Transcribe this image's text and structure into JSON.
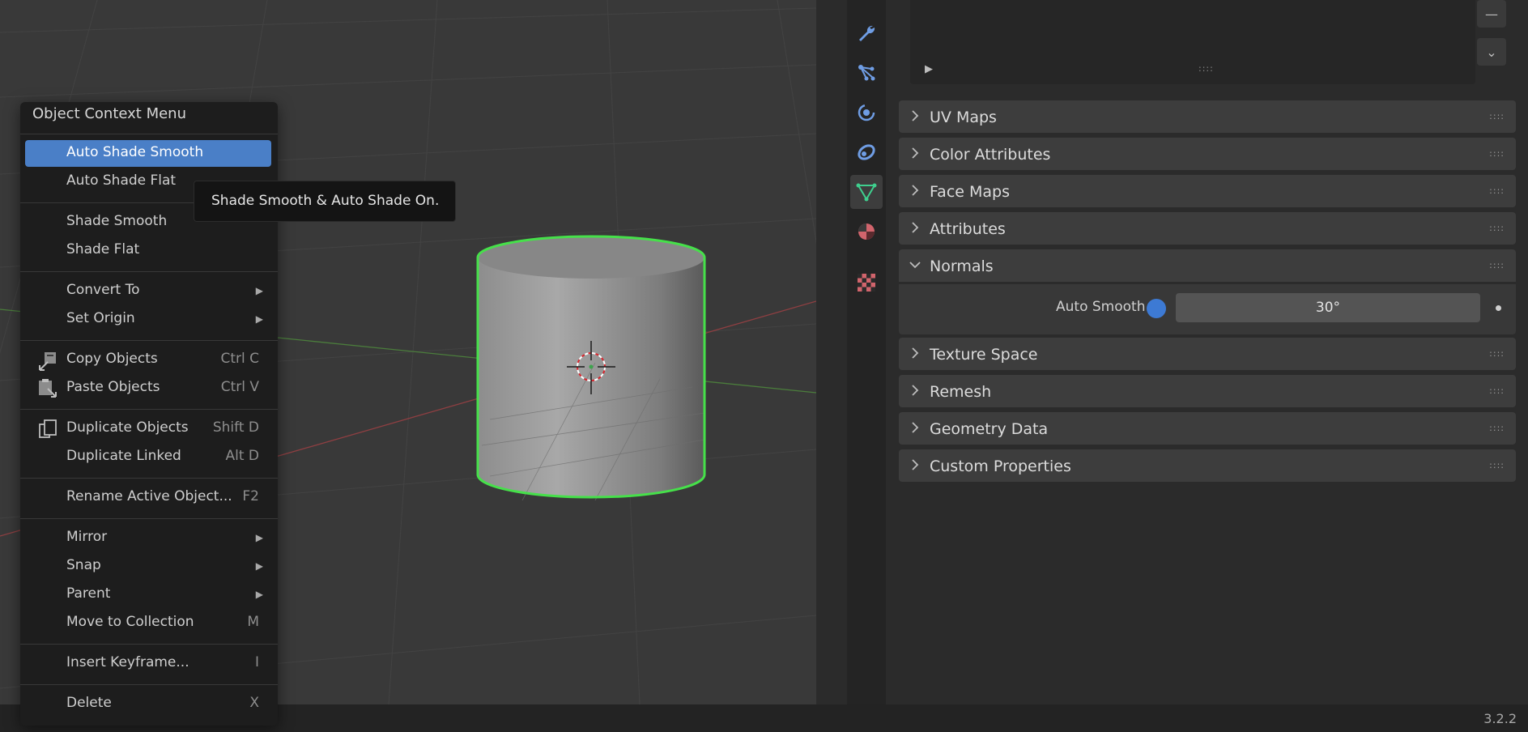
{
  "context_menu": {
    "title": "Object Context Menu",
    "items": [
      {
        "label": "Auto Shade Smooth",
        "shortcut": "",
        "selected": true
      },
      {
        "label": "Auto Shade Flat",
        "shortcut": ""
      },
      {
        "label": "Shade Smooth",
        "shortcut": ""
      },
      {
        "label": "Shade Flat",
        "shortcut": ""
      },
      {
        "label": "Convert To",
        "shortcut": "",
        "submenu": true
      },
      {
        "label": "Set Origin",
        "shortcut": "",
        "submenu": true
      },
      {
        "label": "Copy Objects",
        "shortcut": "Ctrl C",
        "icon": "copy-icon"
      },
      {
        "label": "Paste Objects",
        "shortcut": "Ctrl V",
        "icon": "paste-icon"
      },
      {
        "label": "Duplicate Objects",
        "shortcut": "Shift D",
        "icon": "duplicate-icon"
      },
      {
        "label": "Duplicate Linked",
        "shortcut": "Alt D"
      },
      {
        "label": "Rename Active Object...",
        "shortcut": "F2"
      },
      {
        "label": "Mirror",
        "shortcut": "",
        "submenu": true
      },
      {
        "label": "Snap",
        "shortcut": "",
        "submenu": true
      },
      {
        "label": "Parent",
        "shortcut": "",
        "submenu": true
      },
      {
        "label": "Move to Collection",
        "shortcut": "M"
      },
      {
        "label": "Insert Keyframe...",
        "shortcut": "I"
      },
      {
        "label": "Delete",
        "shortcut": "X"
      }
    ]
  },
  "tooltip": {
    "text": "Shade Smooth & Auto Shade On."
  },
  "properties": {
    "tabs": [
      "modifier-wrench-icon",
      "particles-icon",
      "physics-icon",
      "constraints-icon",
      "object-data-mesh-icon",
      "material-icon",
      "texture-checker-icon"
    ],
    "active_tab": "object-data-mesh-icon",
    "attribute_list": {
      "play_glyph": "▶",
      "grip": "::::"
    },
    "side_buttons": {
      "minus": "—",
      "dropdown": "⌄"
    },
    "panels": {
      "uv_maps": "UV Maps",
      "color_attributes": "Color Attributes",
      "face_maps": "Face Maps",
      "attributes": "Attributes",
      "normals": "Normals",
      "texture_space": "Texture Space",
      "remesh": "Remesh",
      "geometry_data": "Geometry Data",
      "custom_properties": "Custom Properties"
    },
    "normals": {
      "auto_smooth_label": "Auto Smooth",
      "auto_smooth_enabled": true,
      "angle_value": "30°"
    },
    "panel_grip": "::::"
  },
  "status_bar": {
    "version": "3.2.2"
  },
  "colors": {
    "selection_blue": "#4a7fc7",
    "object_outline_green": "#46e04a",
    "active_tab_green": "#3fcf8e",
    "checkbox_blue": "#3d7ad4"
  }
}
